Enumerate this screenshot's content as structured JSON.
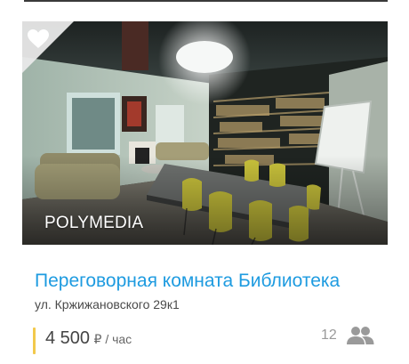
{
  "card": {
    "brand": "POLYMEDIA",
    "title": "Переговорная комната Библиотека",
    "address": "ул. Кржижановского 29к1",
    "price": {
      "value": "4 500",
      "currency": "₽",
      "unit": " / час"
    },
    "capacity": "12",
    "favorite": false
  },
  "icons": {
    "favorite": "heart-icon",
    "capacity": "people-icon"
  },
  "colors": {
    "title": "#1e9be0",
    "price_accent": "#f2c94c",
    "muted": "#9a9a9a"
  }
}
